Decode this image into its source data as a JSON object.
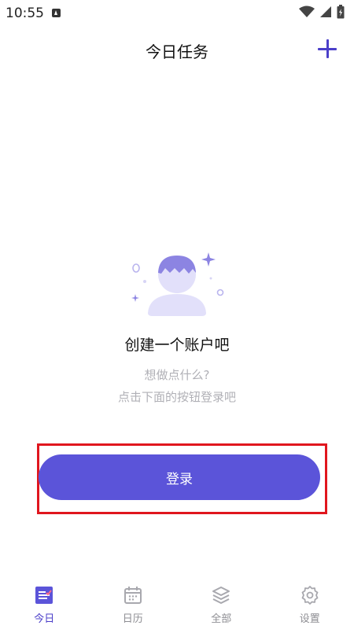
{
  "status_bar": {
    "time": "10:55"
  },
  "header": {
    "title": "今日任务"
  },
  "empty_state": {
    "title": "创建一个账户吧",
    "line1": "想做点什么?",
    "line2": "点击下面的按钮登录吧"
  },
  "login": {
    "label": "登录"
  },
  "nav": {
    "items": [
      {
        "label": "今日",
        "icon": "today-icon"
      },
      {
        "label": "日历",
        "icon": "calendar-icon"
      },
      {
        "label": "全部",
        "icon": "layers-icon"
      },
      {
        "label": "设置",
        "icon": "gear-icon"
      }
    ],
    "active_index": 0
  },
  "colors": {
    "accent": "#5b54d9",
    "highlight": "#e0161e"
  }
}
